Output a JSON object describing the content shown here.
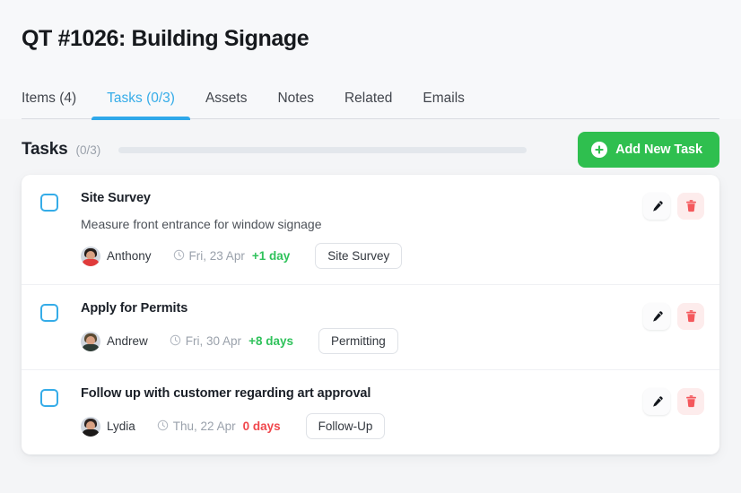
{
  "header": {
    "title": "QT #1026: Building Signage",
    "tabs": [
      {
        "label": "Items (4)",
        "active": false
      },
      {
        "label": "Tasks (0/3)",
        "active": true
      },
      {
        "label": "Assets",
        "active": false
      },
      {
        "label": "Notes",
        "active": false
      },
      {
        "label": "Related",
        "active": false
      },
      {
        "label": "Emails",
        "active": false
      }
    ]
  },
  "section": {
    "title": "Tasks",
    "count": "(0/3)",
    "progress_percent": 0,
    "add_button_label": "Add New Task",
    "add_icon": "plus-circle-icon"
  },
  "colors": {
    "accent_blue": "#35ace8",
    "green": "#2fbf4f",
    "delta_green": "#2fc25b",
    "delta_red": "#f0474c",
    "page_bg": "#f4f5f7",
    "card_bg": "#ffffff"
  },
  "tasks": [
    {
      "title": "Site Survey",
      "description": "Measure front entrance for window signage",
      "assignee": "Anthony",
      "due_date": "Fri, 23 Apr",
      "delta": "+1 day",
      "delta_state": "pos",
      "tag": "Site Survey",
      "checked": false,
      "avatar_hair": "#241d1a",
      "avatar_body": "#e03b3b"
    },
    {
      "title": "Apply for Permits",
      "description": "",
      "assignee": "Andrew",
      "due_date": "Fri, 30 Apr",
      "delta": "+8 days",
      "delta_state": "pos",
      "tag": "Permitting",
      "checked": false,
      "avatar_hair": "#5a4a32",
      "avatar_body": "#2d3b35"
    },
    {
      "title": "Follow up with customer regarding art approval",
      "description": "",
      "assignee": "Lydia",
      "due_date": "Thu, 22 Apr",
      "delta": "0 days",
      "delta_state": "zero",
      "tag": "Follow-Up",
      "checked": false,
      "avatar_hair": "#2c2320",
      "avatar_body": "#1c1a19"
    }
  ],
  "row_actions": {
    "edit_icon": "pencil-icon",
    "delete_icon": "trash-icon"
  }
}
